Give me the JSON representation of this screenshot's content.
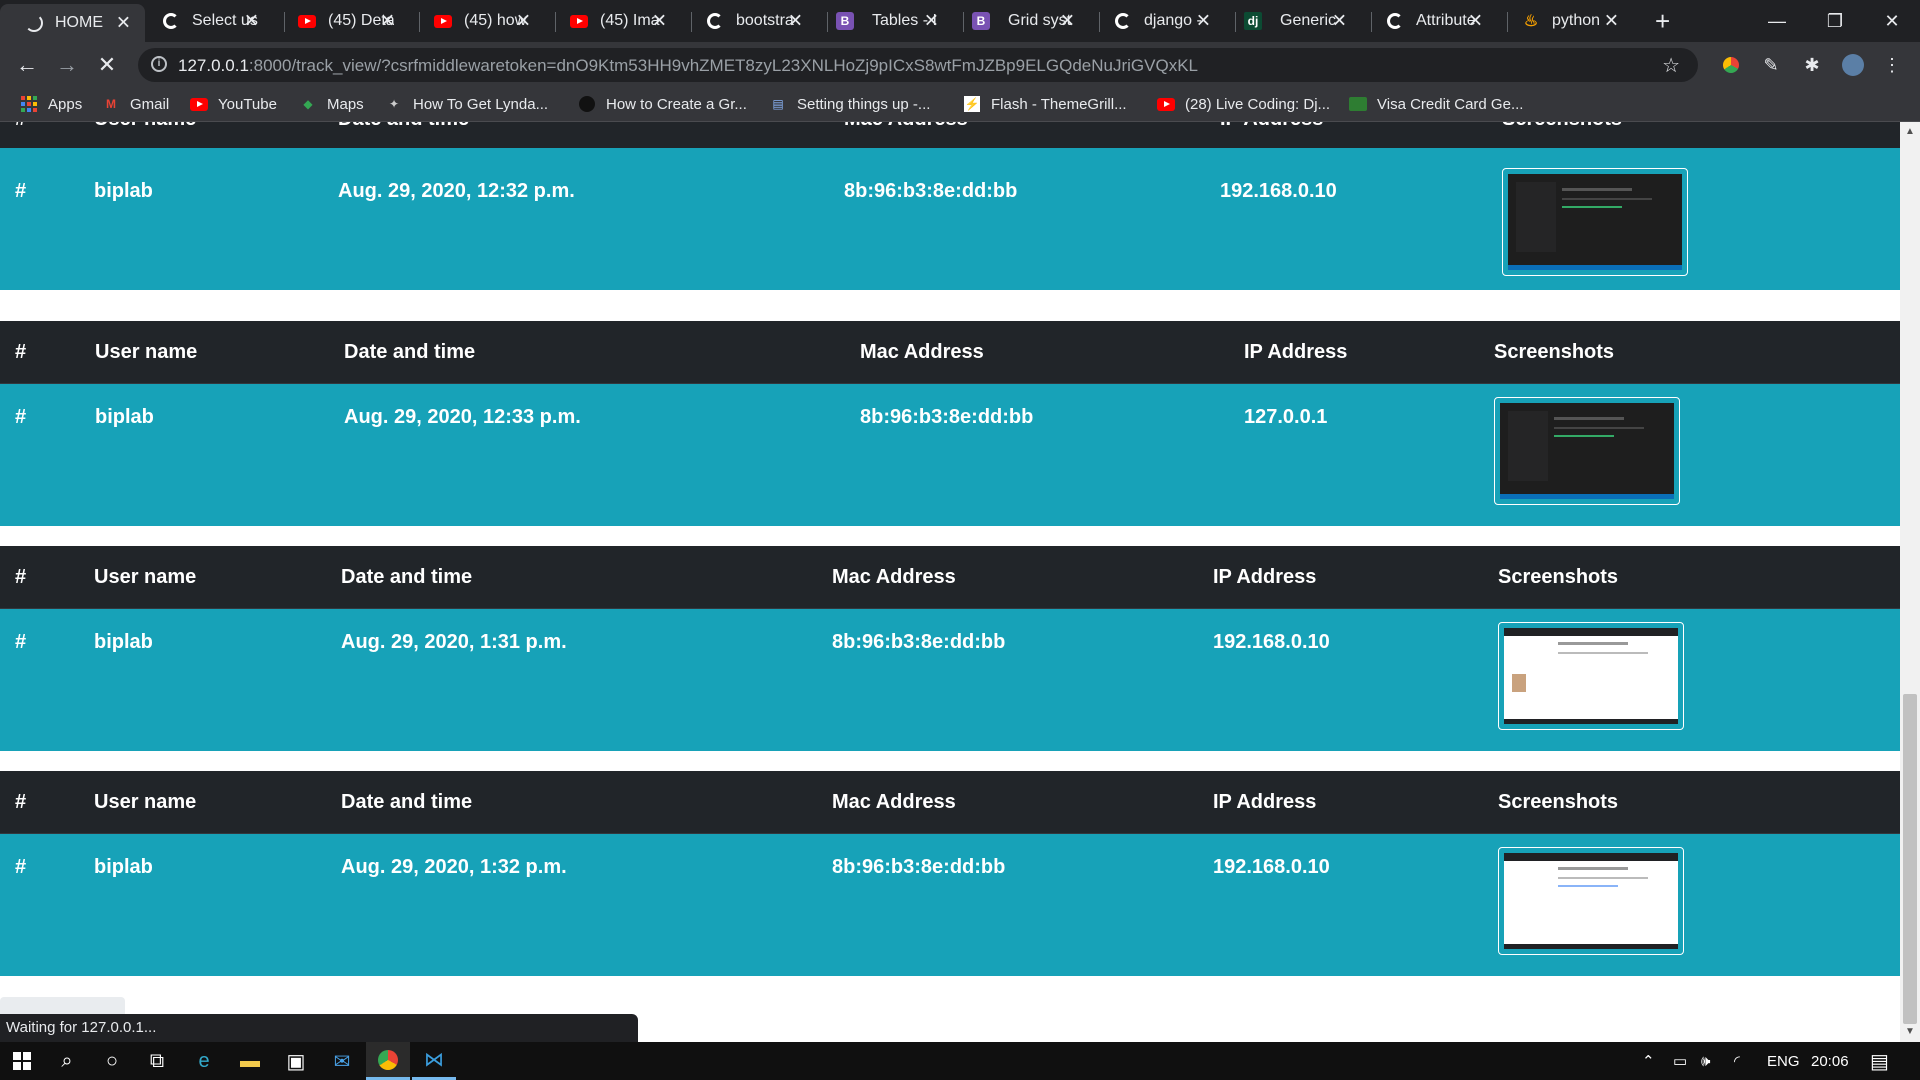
{
  "browser": {
    "tabs": [
      {
        "title": "HOME",
        "icon": "loading-spinner-icon",
        "active": true
      },
      {
        "title": "Select us",
        "icon": "chrome-globe-icon"
      },
      {
        "title": "(45) Deta",
        "icon": "youtube-icon"
      },
      {
        "title": "(45) how",
        "icon": "youtube-icon"
      },
      {
        "title": "(45) Ima",
        "icon": "youtube-icon"
      },
      {
        "title": "bootstra",
        "icon": "google-icon"
      },
      {
        "title": "Tables - I",
        "icon": "bootstrap-icon"
      },
      {
        "title": "Grid syst",
        "icon": "bootstrap-icon"
      },
      {
        "title": "django -",
        "icon": "google-icon"
      },
      {
        "title": "Generic",
        "icon": "django-icon"
      },
      {
        "title": "Attribute",
        "icon": "google-icon"
      },
      {
        "title": "python",
        "icon": "python-icon"
      }
    ],
    "new_tab_label": "+",
    "url_host": "127.0.0.1",
    "url_rest": ":8000/track_view/?csrfmiddlewaretoken=dnO9Ktm53HH9vhZMET8zyL23XNLHoZj9pICxS8wtFmJZBp9ELGQdeNuJriGVQxKL",
    "bookmarks": [
      {
        "label": "Apps",
        "icon": "apps-grid-icon"
      },
      {
        "label": "Gmail",
        "icon": "gmail-icon"
      },
      {
        "label": "YouTube",
        "icon": "youtube-icon"
      },
      {
        "label": "Maps",
        "icon": "maps-icon"
      },
      {
        "label": "How To Get Lynda...",
        "icon": "lynda-icon"
      },
      {
        "label": "How to Create a Gr...",
        "icon": "site-icon"
      },
      {
        "label": "Setting things up -...",
        "icon": "site-icon"
      },
      {
        "label": "Flash - ThemeGrill...",
        "icon": "themegrill-icon"
      },
      {
        "label": "(28) Live Coding: Dj...",
        "icon": "youtube-icon"
      },
      {
        "label": "Visa Credit Card Ge...",
        "icon": "site-icon"
      }
    ],
    "status_text": "Waiting for 127.0.0.1..."
  },
  "table_headers": {
    "hash": "#",
    "user": "User name",
    "datetime": "Date and time",
    "mac": "Mac Address",
    "ip": "IP Address",
    "screens": "Screenshots"
  },
  "records": [
    {
      "hash": "#",
      "user": "biplab",
      "datetime": "Aug. 29, 2020, 12:32 p.m.",
      "mac": "8b:96:b3:8e:dd:bb",
      "ip": "192.168.0.10"
    },
    {
      "hash": "#",
      "user": "biplab",
      "datetime": "Aug. 29, 2020, 12:33 p.m.",
      "mac": "8b:96:b3:8e:dd:bb",
      "ip": "127.0.0.1"
    },
    {
      "hash": "#",
      "user": "biplab",
      "datetime": "Aug. 29, 2020, 1:31 p.m.",
      "mac": "8b:96:b3:8e:dd:bb",
      "ip": "192.168.0.10"
    },
    {
      "hash": "#",
      "user": "biplab",
      "datetime": "Aug. 29, 2020, 1:32 p.m.",
      "mac": "8b:96:b3:8e:dd:bb",
      "ip": "192.168.0.10"
    }
  ],
  "taskbar": {
    "language": "ENG",
    "time": "20:06"
  },
  "colors": {
    "header_bg": "#212529",
    "row_bg": "#17a2b8",
    "chrome_dark": "#202124"
  }
}
